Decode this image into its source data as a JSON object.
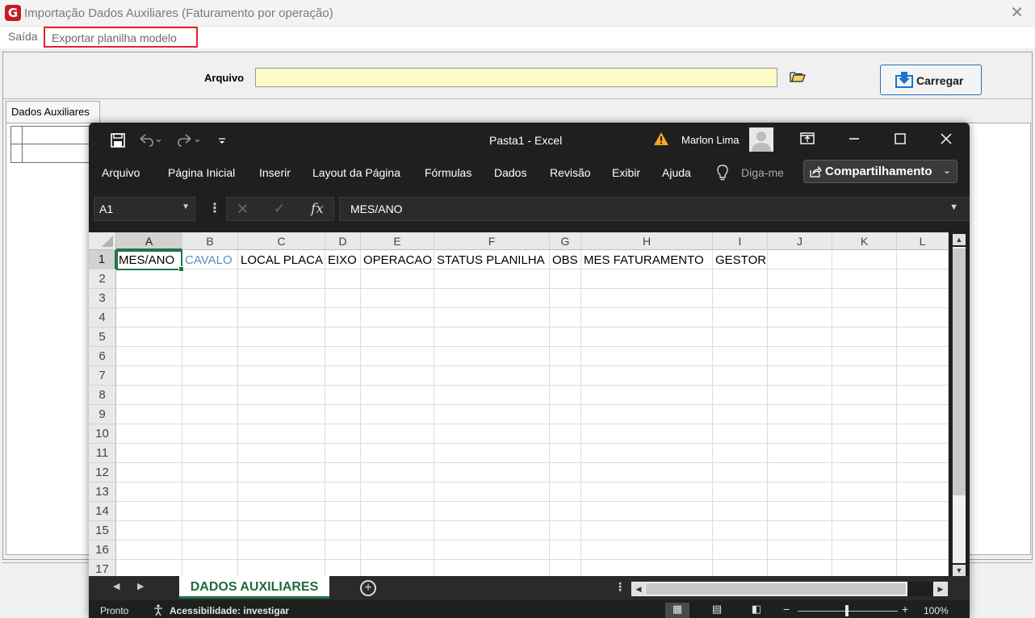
{
  "host": {
    "title": "Importação Dados Auxiliares (Faturamento por operação)",
    "logo_letter": "G",
    "close_glyph": "✕",
    "menu": {
      "exit": "Saída",
      "export": "Exportar planilha modelo"
    },
    "file_label": "Arquivo",
    "file_value": "",
    "load_button": "Carregar",
    "tab": "Dados Auxiliares",
    "accent_color": "#e0232e"
  },
  "excel": {
    "title": "Pasta1  -  Excel",
    "user": "Marlon Lima",
    "ribbon_tabs": [
      "Arquivo",
      "Página Inicial",
      "Inserir",
      "Layout da Página",
      "Fórmulas",
      "Dados",
      "Revisão",
      "Exibir",
      "Ajuda"
    ],
    "tell_me": "Diga-me",
    "share": "Compartilhamento",
    "name_box": "A1",
    "formula": "MES/ANO",
    "fx_label": "fx",
    "columns": [
      "A",
      "B",
      "C",
      "D",
      "E",
      "F",
      "G",
      "H",
      "I",
      "J",
      "K",
      "L"
    ],
    "rows": [
      "1",
      "2",
      "3",
      "4",
      "5",
      "6",
      "7",
      "8",
      "9",
      "10",
      "11",
      "12",
      "13",
      "14",
      "15",
      "16",
      "17"
    ],
    "row1": [
      "MES/ANO",
      "CAVALO",
      "LOCAL PLACA",
      "EIXO",
      "OPERACAO",
      "STATUS PLANILHA",
      "OBS",
      "MES FATURAMENTO",
      "GESTOR"
    ],
    "sheet_tab": "DADOS AUXILIARES",
    "status_ready": "Pronto",
    "status_accessibility": "Acessibilidade: investigar",
    "zoom": "100%",
    "zoom_minus": "−",
    "zoom_plus": "+",
    "selected_cell_color": "#217346"
  }
}
